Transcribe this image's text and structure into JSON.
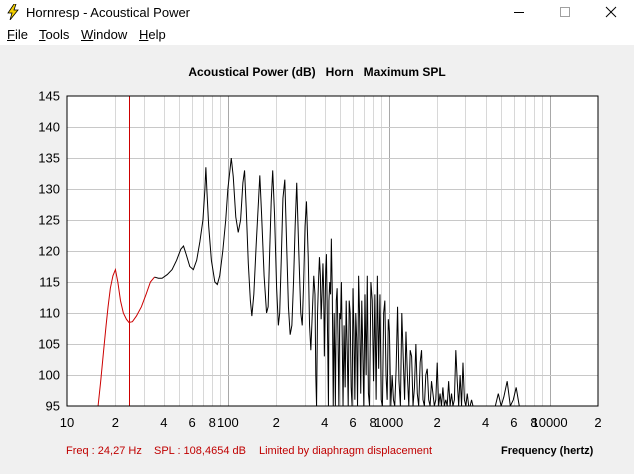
{
  "window": {
    "title": "Hornresp - Acoustical Power"
  },
  "menu": {
    "items": [
      {
        "label": "File",
        "underline": "F"
      },
      {
        "label": "Tools",
        "underline": "T"
      },
      {
        "label": "Window",
        "underline": "W"
      },
      {
        "label": "Help",
        "underline": "H"
      }
    ]
  },
  "chart_title": "Acoustical Power (dB)   Horn   Maximum SPL",
  "status": {
    "freq": "Freq : 24,27 Hz",
    "spl": "SPL : 108,4654 dB",
    "note": "Limited by diaphragm displacement",
    "xaxis_label": "Frequency (hertz)"
  },
  "colors": {
    "curve_low": "#cc0000",
    "curve_main": "#000000",
    "cursor": "#cc0000",
    "grid": "#c8c8c8",
    "status_text": "#c00000"
  },
  "chart_data": {
    "type": "line",
    "x_scale": "log",
    "xlim": [
      10,
      20000
    ],
    "ylim": [
      95,
      145
    ],
    "y_ticks": [
      "95",
      "100",
      "105",
      "110",
      "115",
      "120",
      "125",
      "130",
      "135",
      "140",
      "145"
    ],
    "x_ticks": [
      {
        "v": 10,
        "label": "10"
      },
      {
        "v": 20,
        "label": "2"
      },
      {
        "v": 40,
        "label": "4"
      },
      {
        "v": 60,
        "label": "6"
      },
      {
        "v": 80,
        "label": "8"
      },
      {
        "v": 100,
        "label": "100"
      },
      {
        "v": 200,
        "label": "2"
      },
      {
        "v": 400,
        "label": "4"
      },
      {
        "v": 600,
        "label": "6"
      },
      {
        "v": 800,
        "label": "8"
      },
      {
        "v": 1000,
        "label": "1000"
      },
      {
        "v": 2000,
        "label": "2"
      },
      {
        "v": 4000,
        "label": "4"
      },
      {
        "v": 6000,
        "label": "6"
      },
      {
        "v": 8000,
        "label": "8"
      },
      {
        "v": 10000,
        "label": "10000"
      },
      {
        "v": 20000,
        "label": "2"
      }
    ],
    "cursor_freq": 24.27,
    "series": [
      {
        "color": "low",
        "points": [
          [
            15.6,
            95
          ],
          [
            16.2,
            99
          ],
          [
            16.9,
            104
          ],
          [
            17.5,
            108
          ],
          [
            18.0,
            111
          ],
          [
            18.6,
            114
          ],
          [
            19.3,
            116
          ],
          [
            20.0,
            117
          ],
          [
            20.7,
            115
          ],
          [
            21.5,
            112
          ],
          [
            22.4,
            110
          ],
          [
            23.4,
            109
          ],
          [
            24.27,
            108.47
          ],
          [
            25.5,
            108.6
          ],
          [
            27,
            109.5
          ],
          [
            29,
            111
          ],
          [
            31,
            113
          ],
          [
            33,
            115
          ],
          [
            35,
            115.8
          ]
        ]
      },
      {
        "color": "main",
        "points": [
          [
            35,
            115.8
          ],
          [
            37,
            115.6
          ],
          [
            39,
            115.6
          ],
          [
            42,
            116.2
          ],
          [
            45,
            117
          ],
          [
            48,
            118.5
          ],
          [
            51,
            120.3
          ],
          [
            53,
            120.8
          ],
          [
            55,
            119.5
          ],
          [
            58,
            117.5
          ],
          [
            61,
            117
          ],
          [
            64,
            118.5
          ],
          [
            67,
            121.5
          ],
          [
            70,
            125
          ],
          [
            72,
            130
          ],
          [
            73,
            133.5
          ],
          [
            74,
            130
          ],
          [
            76,
            124
          ],
          [
            79,
            118.5
          ],
          [
            83,
            115
          ],
          [
            86,
            114.6
          ],
          [
            89,
            116
          ],
          [
            93,
            120
          ],
          [
            97,
            125
          ],
          [
            100,
            130
          ],
          [
            103,
            133
          ],
          [
            105,
            135
          ],
          [
            108,
            132
          ],
          [
            112,
            125.5
          ],
          [
            116,
            123
          ],
          [
            120,
            125
          ],
          [
            124,
            131
          ],
          [
            127,
            133
          ],
          [
            130,
            127
          ],
          [
            134,
            118
          ],
          [
            138,
            112
          ],
          [
            141,
            109.5
          ],
          [
            145,
            113
          ],
          [
            150,
            121
          ],
          [
            155,
            128
          ],
          [
            158,
            132.2
          ],
          [
            162,
            126
          ],
          [
            168,
            116
          ],
          [
            174,
            110
          ],
          [
            178,
            111
          ],
          [
            182,
            120
          ],
          [
            186,
            128
          ],
          [
            190,
            133
          ],
          [
            195,
            126
          ],
          [
            201,
            114
          ],
          [
            206,
            108
          ],
          [
            210,
            110
          ],
          [
            215,
            119
          ],
          [
            220,
            128.5
          ],
          [
            226,
            131.5
          ],
          [
            232,
            121
          ],
          [
            238,
            111
          ],
          [
            244,
            106.5
          ],
          [
            250,
            108
          ],
          [
            256,
            115
          ],
          [
            262,
            124
          ],
          [
            268,
            131
          ],
          [
            276,
            120
          ],
          [
            284,
            110
          ],
          [
            290,
            108
          ],
          [
            296,
            115
          ],
          [
            302,
            124
          ],
          [
            308,
            128
          ],
          [
            316,
            119
          ],
          [
            322,
            108
          ],
          [
            328,
            104
          ],
          [
            335,
            110
          ],
          [
            342,
            116
          ],
          [
            348,
            113
          ],
          [
            352,
            100
          ],
          [
            356,
            95
          ]
        ]
      },
      {
        "color": "main",
        "points": [
          [
            356,
            95
          ],
          [
            361,
            110
          ],
          [
            366,
            115
          ],
          [
            371,
            119
          ],
          [
            376,
            116
          ],
          [
            380,
            109
          ],
          [
            385,
            113
          ],
          [
            390,
            118
          ],
          [
            394,
            114
          ],
          [
            398,
            103
          ],
          [
            402,
            110
          ],
          [
            406,
            117
          ],
          [
            410,
            119.5
          ],
          [
            414,
            112
          ],
          [
            418,
            104
          ],
          [
            422,
            95
          ],
          [
            425,
            112
          ],
          [
            430,
            115
          ],
          [
            435,
            113
          ],
          [
            440,
            122
          ],
          [
            446,
            113
          ],
          [
            452,
            95
          ],
          [
            458,
            110
          ],
          [
            462,
            104
          ],
          [
            466,
            95
          ],
          [
            472,
            112
          ],
          [
            478,
            114
          ],
          [
            484,
            106
          ],
          [
            490,
            95
          ],
          [
            496,
            110
          ],
          [
            502,
            109
          ],
          [
            508,
            115
          ],
          [
            514,
            106
          ],
          [
            520,
            95
          ],
          [
            528,
            108
          ],
          [
            536,
            98
          ],
          [
            544,
            112
          ],
          [
            552,
            104
          ],
          [
            560,
            95
          ],
          [
            568,
            112
          ],
          [
            576,
            110
          ],
          [
            584,
            98
          ],
          [
            592,
            95
          ],
          [
            600,
            114
          ],
          [
            608,
            107
          ],
          [
            616,
            96
          ],
          [
            624,
            110
          ],
          [
            632,
            106
          ],
          [
            640,
            95
          ],
          [
            650,
            116
          ],
          [
            660,
            109
          ],
          [
            670,
            97
          ],
          [
            680,
            112
          ],
          [
            690,
            104
          ],
          [
            700,
            95
          ],
          [
            712,
            113
          ],
          [
            724,
            100
          ],
          [
            736,
            116
          ],
          [
            748,
            97
          ],
          [
            760,
            95
          ],
          [
            775,
            115
          ],
          [
            790,
            112
          ],
          [
            805,
            99
          ],
          [
            820,
            113
          ],
          [
            835,
            96
          ],
          [
            850,
            116
          ],
          [
            866,
            101
          ],
          [
            882,
            113
          ],
          [
            898,
            96
          ],
          [
            914,
            95
          ],
          [
            930,
            110
          ],
          [
            946,
            112
          ],
          [
            962,
            100
          ],
          [
            978,
            96
          ],
          [
            994,
            109
          ],
          [
            1010,
            107
          ],
          [
            1030,
            95
          ],
          [
            1050,
            100
          ],
          [
            1070,
            96
          ],
          [
            1090,
            95
          ],
          [
            1112,
            101
          ],
          [
            1135,
            111
          ],
          [
            1158,
            99
          ],
          [
            1182,
            95
          ],
          [
            1206,
            110
          ],
          [
            1230,
            103
          ],
          [
            1255,
            96
          ],
          [
            1280,
            107
          ],
          [
            1306,
            100
          ],
          [
            1333,
            95
          ],
          [
            1360,
            104
          ],
          [
            1388,
            103
          ],
          [
            1416,
            95
          ],
          [
            1445,
            98
          ],
          [
            1475,
            105
          ],
          [
            1505,
            97
          ],
          [
            1536,
            95
          ],
          [
            1568,
            102
          ],
          [
            1600,
            104
          ],
          [
            1633,
            96
          ],
          [
            1667,
            95
          ],
          [
            1700,
            100
          ],
          [
            1736,
            101
          ],
          [
            1772,
            96
          ],
          [
            1808,
            95
          ],
          [
            1845,
            99
          ],
          [
            1883,
            97
          ],
          [
            1922,
            95
          ],
          [
            1962,
            96
          ],
          [
            2002,
            102
          ],
          [
            2043,
            95
          ],
          [
            2085,
            97
          ],
          [
            2128,
            95
          ],
          [
            2172,
            98
          ],
          [
            2217,
            95
          ],
          [
            2263,
            96
          ],
          [
            2310,
            95
          ],
          [
            2358,
            99
          ],
          [
            2407,
            95
          ],
          [
            2457,
            97
          ],
          [
            2508,
            95
          ],
          [
            2560,
            96
          ],
          [
            2613,
            104
          ],
          [
            2667,
            99
          ],
          [
            2722,
            95
          ],
          [
            2779,
            100
          ],
          [
            2836,
            95
          ],
          [
            2895,
            102
          ],
          [
            2955,
            96
          ],
          [
            3016,
            95
          ],
          [
            3078,
            97
          ],
          [
            3142,
            95
          ],
          [
            3207,
            95
          ],
          [
            3273,
            96
          ],
          [
            3340,
            95
          ],
          [
            3400,
            95
          ]
        ]
      },
      {
        "color": "main",
        "points": [
          [
            4600,
            95
          ],
          [
            4800,
            97
          ],
          [
            5000,
            95
          ],
          [
            5200,
            96.5
          ],
          [
            5450,
            99
          ],
          [
            5700,
            95
          ],
          [
            5950,
            96
          ],
          [
            6200,
            98
          ],
          [
            6480,
            95
          ]
        ]
      }
    ]
  }
}
